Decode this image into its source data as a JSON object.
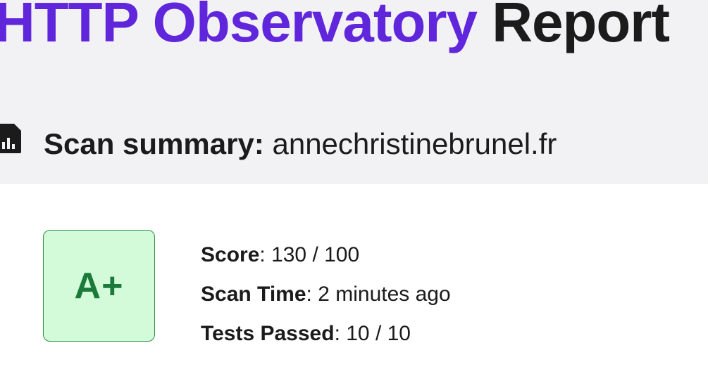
{
  "header": {
    "title_accent": "HTTP Observatory",
    "title_rest": "Report"
  },
  "summary": {
    "icon": "report-document-icon",
    "label": "Scan summary:",
    "domain": "annechristinebrunel.fr"
  },
  "grade": {
    "value": "A+",
    "color": "#1b7a3a",
    "background": "#d3fad9"
  },
  "stats": [
    {
      "label": "Score",
      "separator": ": ",
      "value": "130 / 100"
    },
    {
      "label": "Scan Time",
      "separator": ": ",
      "value": "2 minutes ago"
    },
    {
      "label": "Tests Passed",
      "separator": ": ",
      "value": "10 / 10"
    }
  ],
  "colors": {
    "accent": "#6026db",
    "band": "#f2f1f4",
    "text": "#1b1b1b"
  }
}
